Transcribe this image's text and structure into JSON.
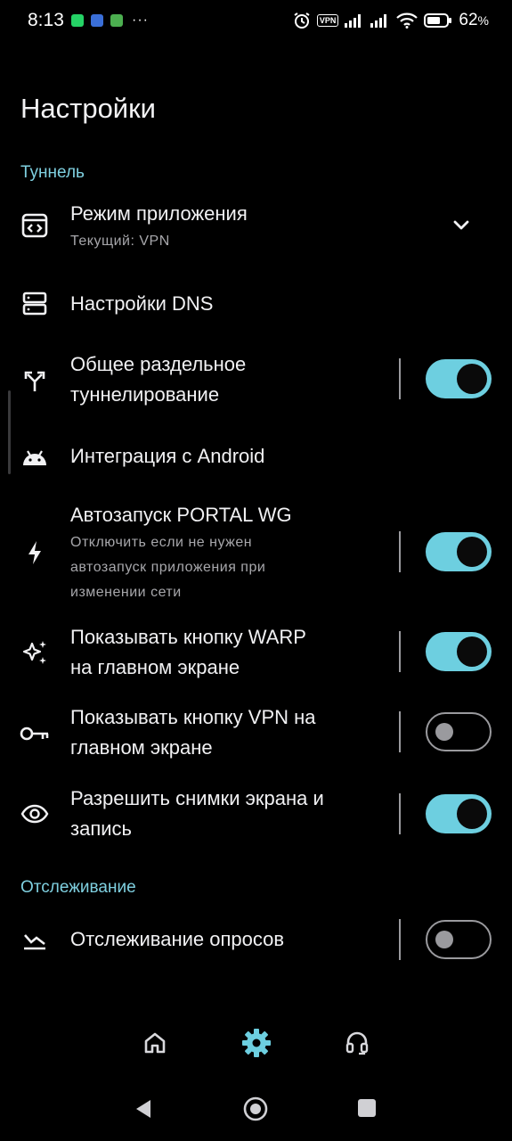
{
  "status_bar": {
    "time": "8:13",
    "vpn_badge": "VPN",
    "battery_percent": "62",
    "battery_suffix": "%",
    "overflow_dots": "···"
  },
  "page": {
    "title": "Настройки"
  },
  "sections": {
    "tunnel": "Туннель",
    "tracking": "Отслеживание"
  },
  "settings": {
    "app_mode": {
      "label": "Режим приложения",
      "sub": "Текущий: VPN"
    },
    "dns": {
      "label": "Настройки DNS"
    },
    "split_tunnel": {
      "label_line1": "Общее раздельное",
      "label_line2": "туннелирование",
      "toggle": true
    },
    "android_integration": {
      "label": "Интеграция с Android"
    },
    "autostart": {
      "label": "Автозапуск PORTAL WG",
      "sub_line1": "Отключить если не нужен",
      "sub_line2": "автозапуск приложения при",
      "sub_line3": "изменении сети",
      "toggle": true
    },
    "warp_button": {
      "label_line1": "Показывать кнопку WARP",
      "label_line2": "на главном экране",
      "toggle": true
    },
    "vpn_button": {
      "label_line1": "Показывать кнопку VPN на",
      "label_line2": "главном экране",
      "toggle": false
    },
    "screenshots": {
      "label_line1": "Разрешить снимки экрана и",
      "label_line2": "запись",
      "toggle": true
    },
    "poll_tracking": {
      "label": "Отслеживание опросов",
      "toggle": false
    }
  },
  "bottom_nav": {
    "items": [
      {
        "icon": "home-icon",
        "active": false
      },
      {
        "icon": "gear-icon",
        "active": true
      },
      {
        "icon": "headset-icon",
        "active": false
      }
    ]
  },
  "colors": {
    "accent": "#6dcfe0",
    "section_header": "#7fd0e0",
    "background": "#000000",
    "toggle_off": "#9a9a9e"
  }
}
